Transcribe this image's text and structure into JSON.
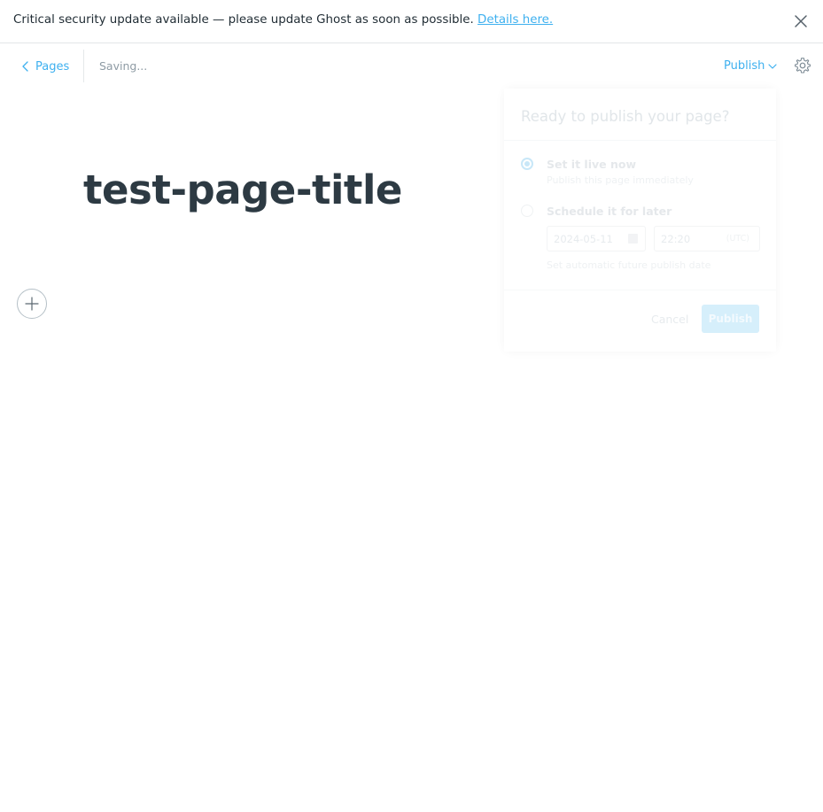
{
  "banner": {
    "message": "Critical security update available — please update Ghost as soon as possible.",
    "link_text": "Details here."
  },
  "header": {
    "back_label": "Pages",
    "status": "Saving...",
    "publish_label": "Publish"
  },
  "editor": {
    "title": "test-page-title"
  },
  "publish_menu": {
    "heading": "Ready to publish your page?",
    "options": [
      {
        "title": "Set it live now",
        "description": "Publish this page immediately",
        "selected": true
      },
      {
        "title": "Schedule it for later",
        "description": "Set automatic future publish date",
        "selected": false
      }
    ],
    "date_value": "2024-05-11",
    "time_value": "22:20",
    "timezone": "(UTC)",
    "cancel_label": "Cancel",
    "publish_label": "Publish"
  },
  "colors": {
    "accent": "#3eb0ef",
    "title": "#2d3a43"
  },
  "icons": [
    "close-icon",
    "chevron-left-icon",
    "chevron-down-icon",
    "gear-icon",
    "plus-icon",
    "calendar-icon"
  ]
}
